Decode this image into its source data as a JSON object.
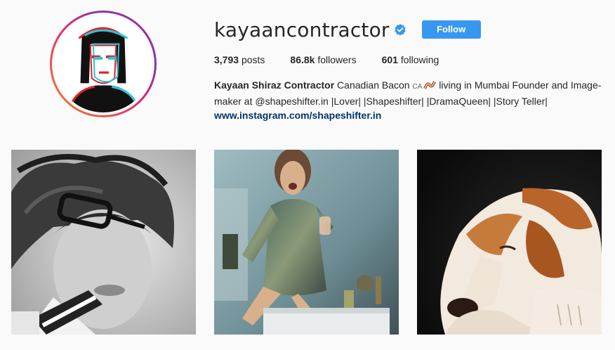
{
  "profile": {
    "username": "kayaancontractor",
    "verified": true,
    "follow_label": "Follow",
    "stats": {
      "posts_count": "3,793",
      "posts_label": "posts",
      "followers_count": "86.8k",
      "followers_label": "followers",
      "following_count": "601",
      "following_label": "following"
    },
    "bio": {
      "name": "Kayaan Shiraz Contractor",
      "text_line1": " Canadian Bacon ",
      "flag_text": "CA",
      "text_line1b": " living in Mumbai Founder and Image-",
      "text_line2": "maker at @shapeshifter.in |Lover| |Shapeshifter| |DramaQueen| |Story Teller|",
      "link": "www.instagram.com/shapeshifter.in"
    }
  },
  "posts": [
    {
      "subject": "black-and-white portrait with glasses"
    },
    {
      "subject": "woman in sequin dress holding glass"
    },
    {
      "subject": "sleeping beagle puppy"
    }
  ],
  "colors": {
    "accent": "#3897f0",
    "link": "#003569",
    "background": "#fafafa"
  }
}
